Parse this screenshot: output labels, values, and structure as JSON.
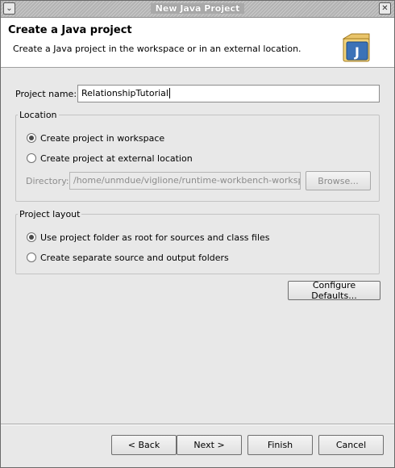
{
  "window": {
    "title": "New Java Project"
  },
  "header": {
    "title": "Create a Java project",
    "description": "Create a Java project in the workspace or in an external location."
  },
  "project_name": {
    "label": "Project name:",
    "value": "RelationshipTutorial"
  },
  "location": {
    "title": "Location",
    "options": [
      {
        "label": "Create project in workspace",
        "selected": true
      },
      {
        "label": "Create project at external location",
        "selected": false
      }
    ],
    "directory_label": "Directory:",
    "directory_value": "/home/unmdue/viglione/runtime-workbench-workspace/",
    "browse_label": "Browse..."
  },
  "project_layout": {
    "title": "Project layout",
    "options": [
      {
        "label": "Use project folder as root for sources and class files",
        "selected": true
      },
      {
        "label": "Create separate source and output folders",
        "selected": false
      }
    ]
  },
  "configure_defaults_label": "Configure Defaults...",
  "footer": {
    "back_label": "< Back",
    "next_label": "Next >",
    "finish_label": "Finish",
    "cancel_label": "Cancel"
  }
}
